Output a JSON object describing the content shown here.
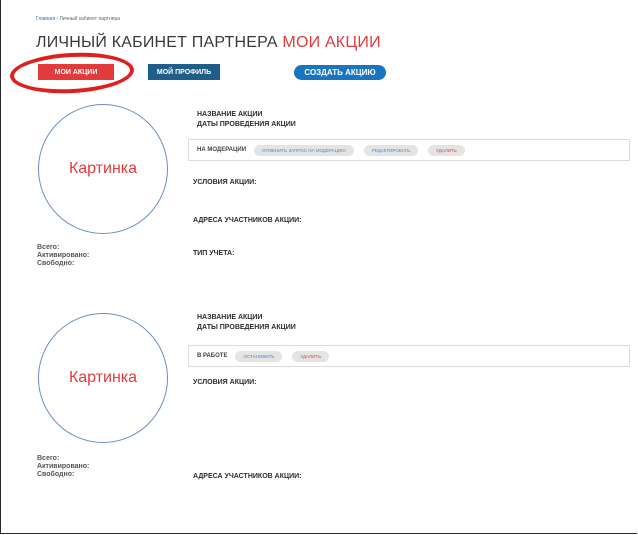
{
  "breadcrumb": {
    "home": "Главная",
    "separator": " › ",
    "current": "Личный кабинет партнера"
  },
  "title": {
    "main": "ЛИЧНЫЙ КАБИНЕТ ПАРТНЕРА",
    "accent": "МОИ АКЦИИ"
  },
  "nav": {
    "my_actions": "МОИ АКЦИИ",
    "my_profile": "МОЙ ПРОФИЛЬ",
    "create_action": "СОЗДАТЬ АКЦИЮ"
  },
  "cards": [
    {
      "image_label": "Картинка",
      "name_label": "НАЗВАНИЕ АКЦИИ",
      "dates_label": "ДАТЫ ПРОВЕДЕНИЯ АКЦИИ",
      "status": "НА МОДЕРАЦИИ",
      "actions": [
        "ОТМЕНИТЬ ЗАПРОС НА МОДЕРАЦИЮ",
        "РЕДАКТИРОВАТЬ",
        "УДАЛИТЬ"
      ],
      "conditions_label": "УСЛОВИЯ АКЦИИ:",
      "addresses_label": "АДРЕСА УЧАСТНИКОВ АКЦИИ:",
      "account_type_label": "ТИП УЧЕТА:",
      "stats": {
        "total": "Всего:",
        "activated": "Активировано:",
        "free": "Свободно:"
      }
    },
    {
      "image_label": "Картинка",
      "name_label": "НАЗВАНИЕ АКЦИИ",
      "dates_label": "ДАТЫ ПРОВЕДЕНИЯ АКЦИИ",
      "status": "В РАБОТЕ",
      "actions": [
        "ОСТАНОВИТЬ",
        "УДАЛИТЬ"
      ],
      "conditions_label": "УСЛОВИЯ АКЦИИ:",
      "addresses_label": "АДРЕСА УЧАСТНИКОВ АКЦИИ:",
      "stats": {
        "total": "Всего:",
        "activated": "Активировано:",
        "free": "Свободно:"
      }
    }
  ],
  "colors": {
    "accent_red": "#e23b3b",
    "profile_blue": "#1f5e8a",
    "create_blue": "#1a75c0",
    "highlight_ellipse": "#e11d1d",
    "circle_border": "#6a8fc4"
  }
}
